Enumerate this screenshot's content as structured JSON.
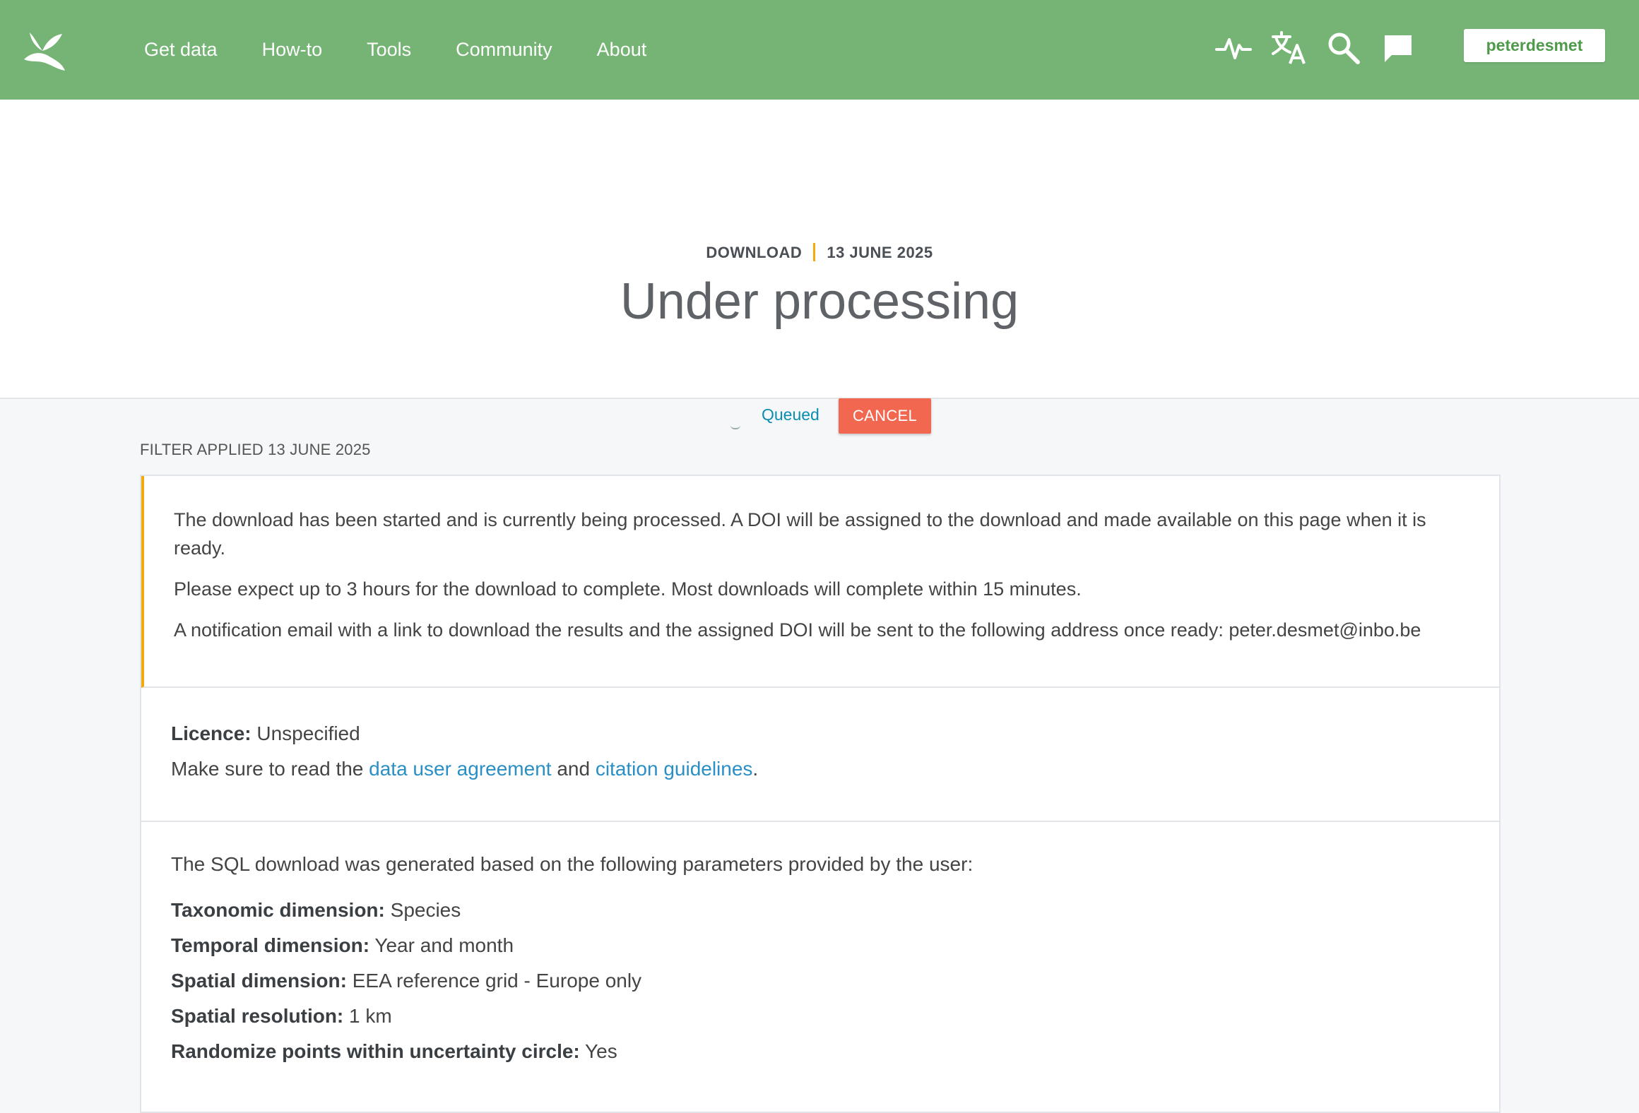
{
  "nav": {
    "items": [
      "Get data",
      "How-to",
      "Tools",
      "Community",
      "About"
    ]
  },
  "header_icons": [
    "activity-icon",
    "translate-icon",
    "search-icon",
    "feedback-icon"
  ],
  "user": {
    "name": "peterdesmet"
  },
  "hero": {
    "category": "DOWNLOAD",
    "date": "13 JUNE 2025",
    "title": "Under processing",
    "status": "Queued",
    "cancel_label": "CANCEL"
  },
  "filter": {
    "label": "FILTER APPLIED 13 JUNE 2025"
  },
  "notice": {
    "p1": "The download has been started and is currently being processed. A DOI will be assigned to the download and made available on this page when it is ready.",
    "p2": "Please expect up to 3 hours for the download to complete. Most downloads will complete within 15 minutes.",
    "p3": "A notification email with a link to download the results and the assigned DOI will be sent to the following address once ready: peter.desmet@inbo.be"
  },
  "licence": {
    "label": "Licence:",
    "value": "Unspecified",
    "text_before": "Make sure to read the",
    "link1": "data user agreement",
    "text_mid": "and",
    "link2": "citation guidelines",
    "text_after": "."
  },
  "params": {
    "intro": "The SQL download was generated based on the following parameters provided by the user:",
    "rows": [
      {
        "label": "Taxonomic dimension:",
        "value": "Species"
      },
      {
        "label": "Temporal dimension:",
        "value": "Year and month"
      },
      {
        "label": "Spatial dimension:",
        "value": "EEA reference grid - Europe only"
      },
      {
        "label": "Spatial resolution:",
        "value": "1 km"
      },
      {
        "label": "Randomize points within uncertainty circle:",
        "value": "Yes"
      }
    ]
  },
  "colors": {
    "header_bg": "#75b474",
    "accent": "#f1a90d",
    "cancel": "#f2674f",
    "link": "#2a8fc4",
    "status": "#0b8db0"
  }
}
